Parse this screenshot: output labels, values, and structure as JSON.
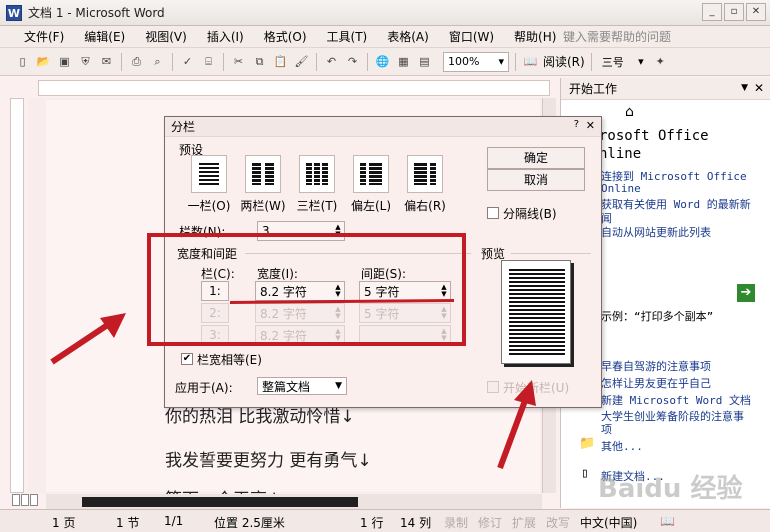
{
  "window": {
    "title": "文档 1 - Microsoft Word"
  },
  "menu": [
    "文件(F)",
    "编辑(E)",
    "视图(V)",
    "插入(I)",
    "格式(O)",
    "工具(T)",
    "表格(A)",
    "窗口(W)",
    "帮助(H)"
  ],
  "help_placeholder": "键入需要帮助的问题",
  "toolbar": {
    "zoom": "100%",
    "read_label": "阅读(R)",
    "font_size": "三号"
  },
  "document": {
    "lines": [
      "你的热泪 比我激动怜惜↓",
      "我发誓要更努力 更有勇气↓",
      "等下一个天亮↓"
    ]
  },
  "statusbar": {
    "page": "1 页",
    "section": "1 节",
    "pages": "1/1",
    "position": "位置 2.5厘米",
    "line": "1 行",
    "col": "14 列",
    "rec": "录制",
    "trk": "修订",
    "ext": "扩展",
    "ovr": "改写",
    "lang": "中文(中国)"
  },
  "taskpane": {
    "title": "开始工作",
    "office_heading_1": "rosoft Office",
    "office_heading_2": "nline",
    "links": [
      "连接到 Microsoft Office",
      "Online",
      "获取有关使用 Word 的最新新",
      "闻",
      "自动从网站更新此列表"
    ],
    "example": "示例：“打印多个副本”",
    "recent": [
      "早春自驾游的注意事项",
      "怎样让男友更在乎自己",
      "新建 Microsoft Word 文档",
      "大学生创业筹备阶段的注意事",
      "项"
    ],
    "other": "其他...",
    "new_doc": "新建文档..."
  },
  "dialog": {
    "title": "分栏",
    "preset_label": "预设",
    "presets": [
      "一栏(O)",
      "两栏(W)",
      "三栏(T)",
      "偏左(L)",
      "偏右(R)"
    ],
    "columns_label": "栏数(N):",
    "columns_value": "3",
    "width_spacing_label": "宽度和间距",
    "col_header": "栏(C):",
    "width_header": "宽度(I):",
    "spacing_header": "间距(S):",
    "row1": {
      "num": "1:",
      "width": "8.2 字符",
      "spacing": "5 字符"
    },
    "row2": {
      "num": "2:",
      "width": "8.2 字符",
      "spacing": "5 字符"
    },
    "row3": {
      "num": "3:",
      "width": "8.2 字符",
      "spacing": ""
    },
    "equal_width": "栏宽相等(E)",
    "apply_label": "应用于(A):",
    "apply_value": "整篇文档",
    "ok": "确定",
    "cancel": "取消",
    "divider": "分隔线(B)",
    "preview_label": "预览",
    "new_column": "开始新栏(U)"
  },
  "watermark": "Baidu 经验"
}
